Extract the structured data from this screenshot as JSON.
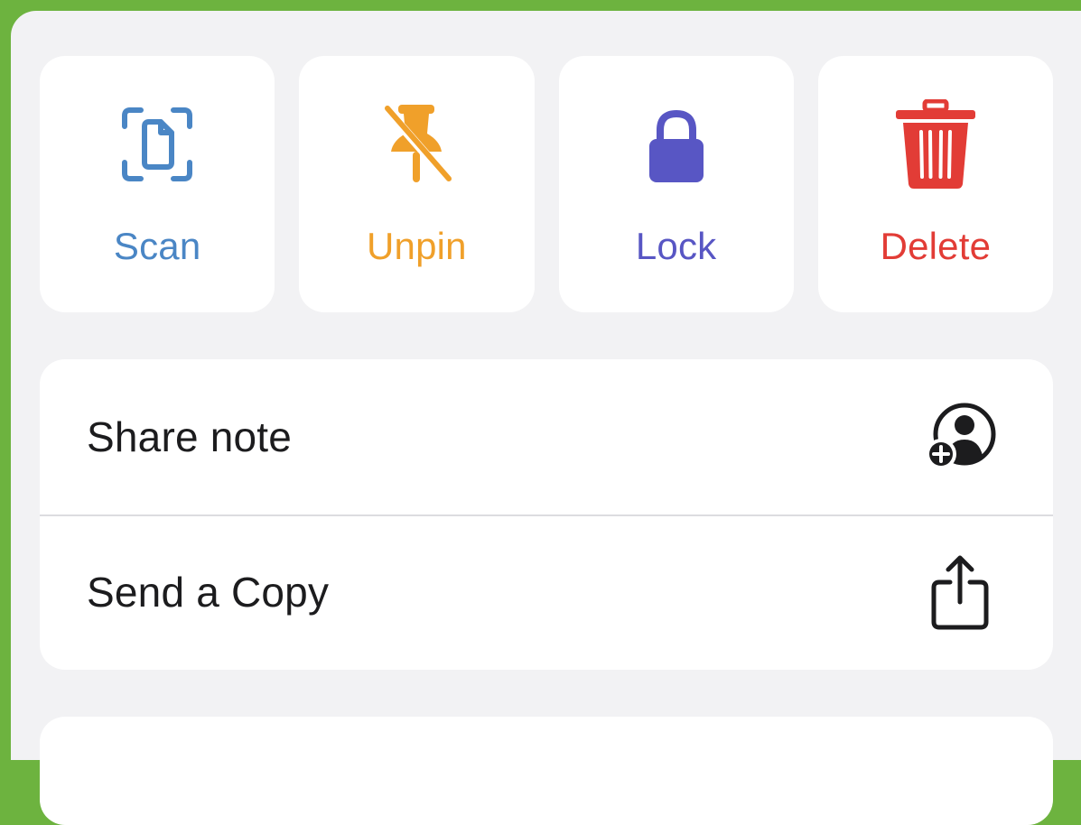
{
  "colors": {
    "frame_border": "#6db33f",
    "sheet_background": "#f2f2f4",
    "scan": "#4a86c5",
    "unpin": "#f0a02a",
    "lock": "#5856c4",
    "delete": "#e23c36",
    "text_primary": "#1c1c1e"
  },
  "actions": [
    {
      "label": "Scan",
      "icon": "scan-document-icon",
      "color": "#4a86c5"
    },
    {
      "label": "Unpin",
      "icon": "pin-slash-icon",
      "color": "#f0a02a"
    },
    {
      "label": "Lock",
      "icon": "lock-icon",
      "color": "#5856c4"
    },
    {
      "label": "Delete",
      "icon": "trash-icon",
      "color": "#e23c36"
    }
  ],
  "menu": {
    "items": [
      {
        "label": "Share note",
        "icon": "add-person-icon"
      },
      {
        "label": "Send a Copy",
        "icon": "share-icon"
      }
    ]
  }
}
